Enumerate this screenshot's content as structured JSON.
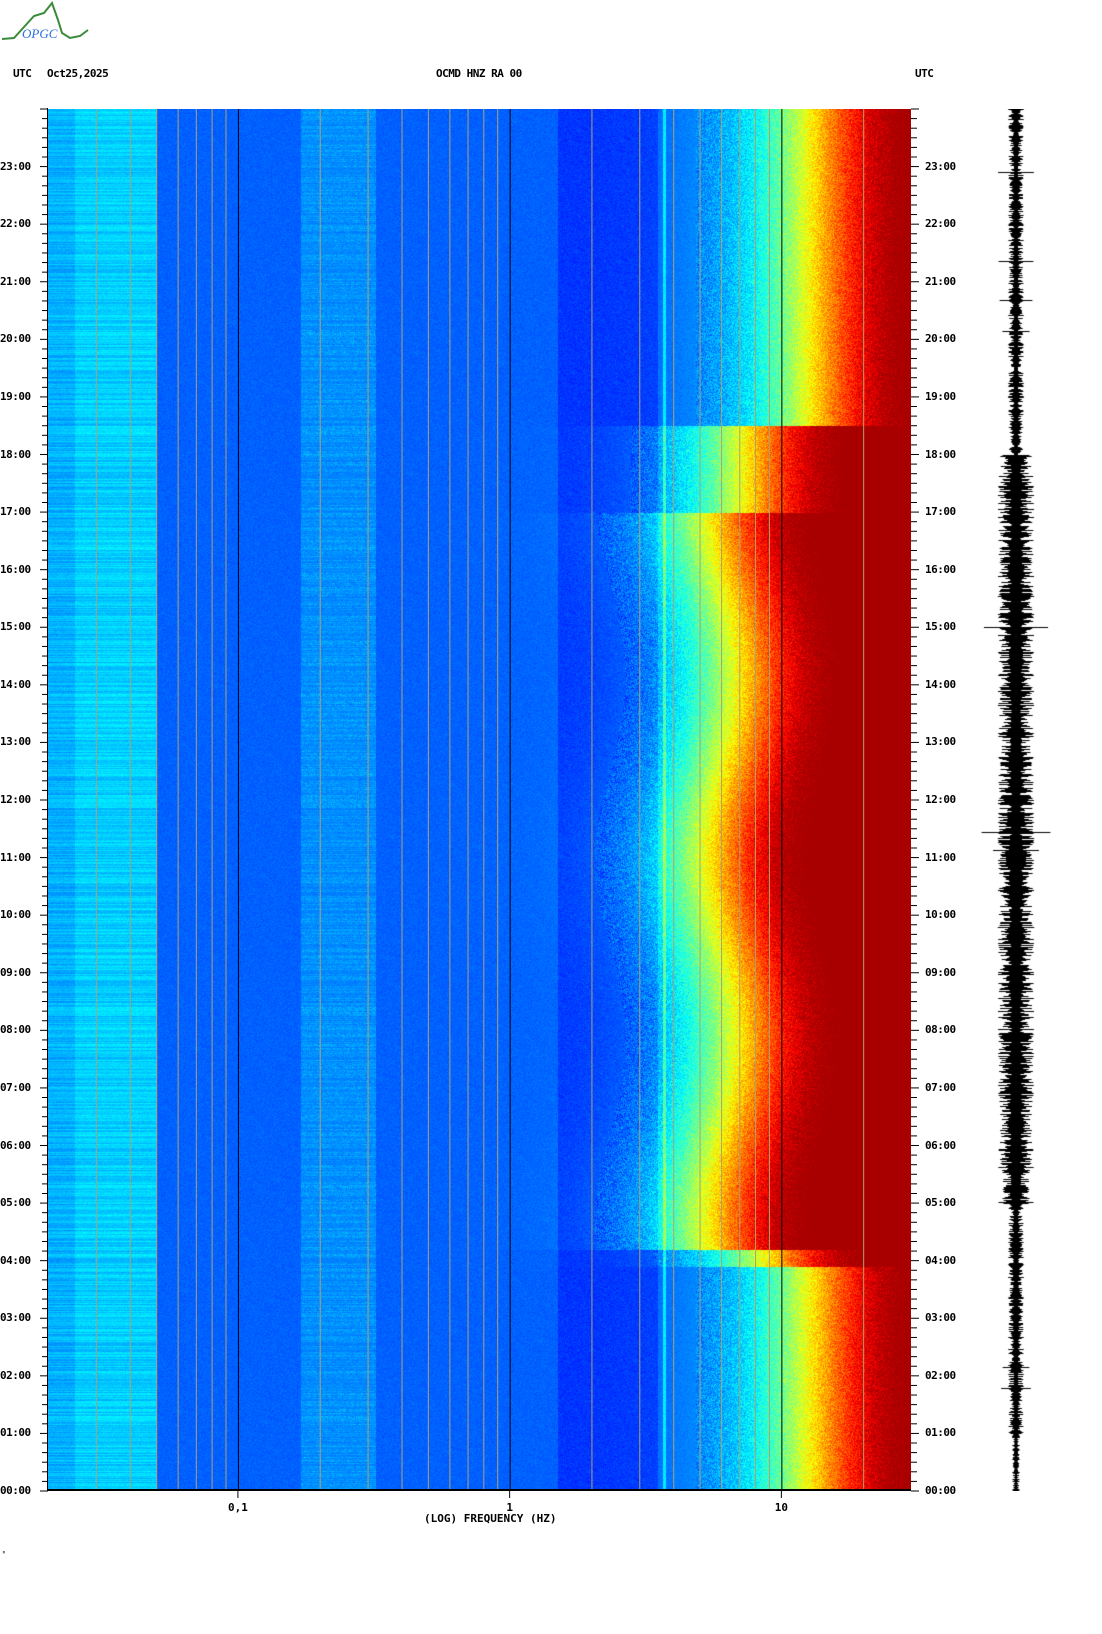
{
  "logo": {
    "text": "OPGC"
  },
  "header": {
    "left_tz": "UTC",
    "date": "Oct25,2025",
    "title": "OCMD HNZ RA 00",
    "right_tz": "UTC"
  },
  "footer_mark": "ᴿ",
  "chart_data": {
    "type": "heatmap",
    "title": "OCMD HNZ RA 00",
    "xlabel": "(LOG) FREQUENCY (HZ)",
    "xscale": "log",
    "xlim": [
      0.02,
      30
    ],
    "x_ticks": [
      {
        "value": 0.1,
        "label": "0,1"
      },
      {
        "value": 1,
        "label": "1"
      },
      {
        "value": 10,
        "label": "10"
      }
    ],
    "x_grid_minor": [
      0.03,
      0.04,
      0.05,
      0.06,
      0.07,
      0.08,
      0.09,
      0.2,
      0.3,
      0.4,
      0.5,
      0.6,
      0.7,
      0.8,
      0.9,
      2,
      3,
      4,
      5,
      6,
      7,
      8,
      9,
      20
    ],
    "x_grid_major": [
      0.1,
      1,
      10
    ],
    "ylabel": "UTC",
    "ylim_hours": [
      0,
      24
    ],
    "y_ticks": [
      "00:00",
      "01:00",
      "02:00",
      "03:00",
      "04:00",
      "05:00",
      "06:00",
      "07:00",
      "08:00",
      "09:00",
      "10:00",
      "11:00",
      "12:00",
      "13:00",
      "14:00",
      "15:00",
      "16:00",
      "17:00",
      "18:00",
      "19:00",
      "20:00",
      "21:00",
      "22:00",
      "23:00"
    ],
    "colormap": "jet",
    "description_values": {
      "daytime_high_power_edge_hz": 6,
      "night_high_power_edge_hz": 12,
      "persistent_line_hz": 3.7
    },
    "colors": {
      "major_grid": "#000000",
      "minor_grid": "#b0a070",
      "trace": "#000000"
    }
  }
}
